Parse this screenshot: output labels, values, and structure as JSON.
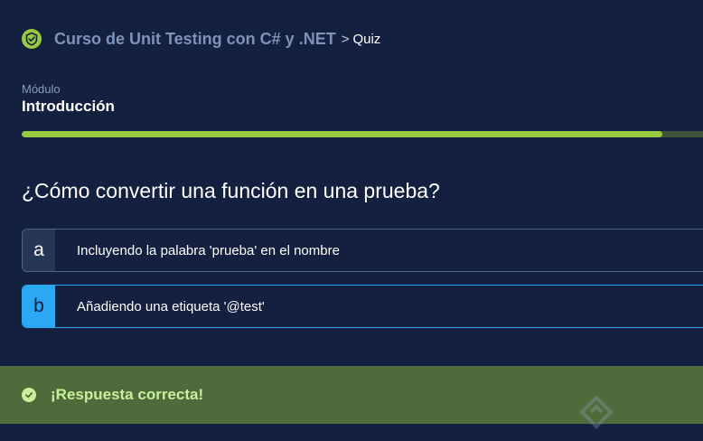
{
  "header": {
    "course_title": "Curso de Unit Testing con C# y .NET",
    "separator": ">",
    "current": "Quiz",
    "logo_icon": "course-badge-icon"
  },
  "module": {
    "label": "Módulo",
    "name": "Introducción",
    "progress_percent": 94
  },
  "question": {
    "text": "¿Cómo convertir una función en una prueba?"
  },
  "options": [
    {
      "letter": "a",
      "text": "Incluyendo la palabra 'prueba' en el nombre",
      "selected": false
    },
    {
      "letter": "b",
      "text": "Añadiendo una etiqueta '@test'",
      "selected": true
    }
  ],
  "feedback": {
    "text": "¡Respuesta correcta!",
    "icon": "check-circle-icon"
  },
  "colors": {
    "background": "#13203f",
    "accent_green": "#98ca3f",
    "selected_blue": "#2aa8f2",
    "feedback_bg": "#4e6c3b",
    "feedback_text": "#c9f09a"
  }
}
